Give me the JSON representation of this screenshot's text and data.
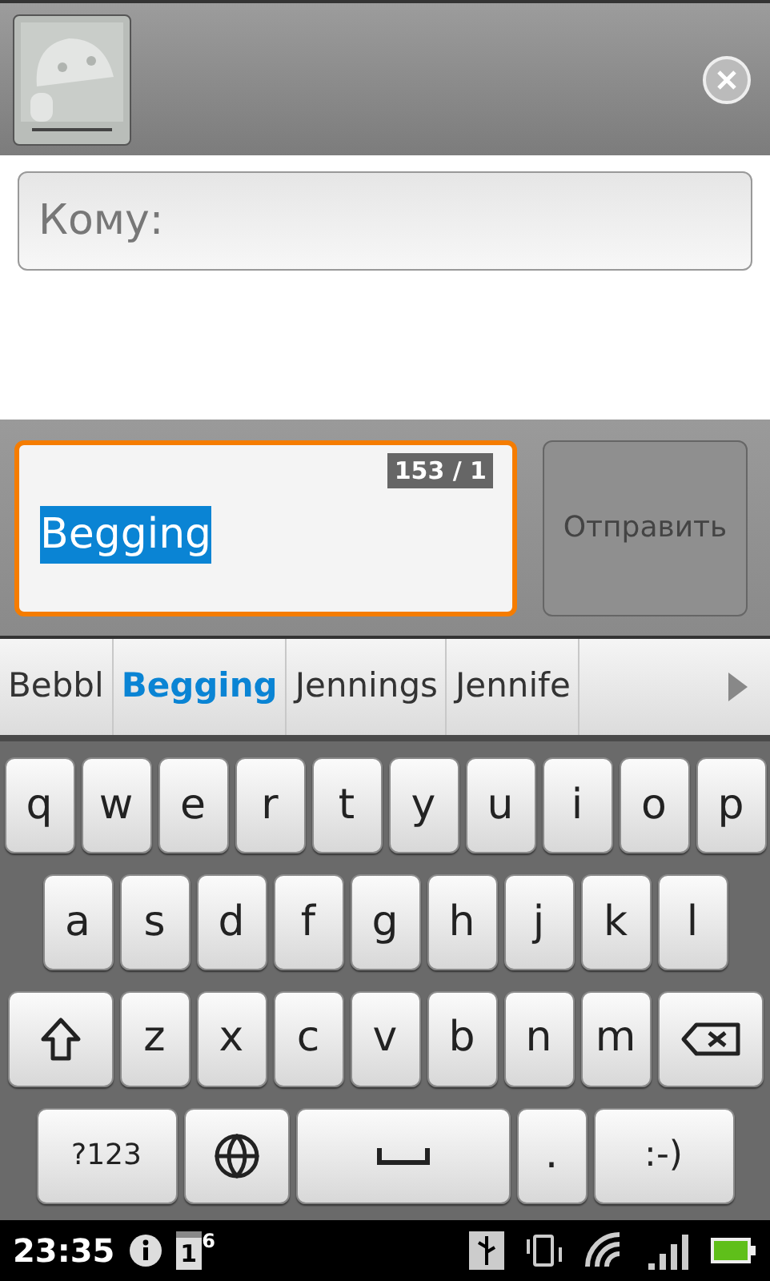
{
  "to_field": {
    "placeholder": "Кому:"
  },
  "compose": {
    "value": "Begging",
    "counter": "153 / 1",
    "focused": true
  },
  "send_button": {
    "label": "Отправить",
    "disabled": true
  },
  "suggestions": [
    {
      "text": "Bebbl",
      "selected": false
    },
    {
      "text": "Begging",
      "selected": true
    },
    {
      "text": "Jennings",
      "selected": false
    },
    {
      "text": "Jennife",
      "selected": false
    }
  ],
  "keyboard": {
    "rows": [
      [
        {
          "kind": "letter",
          "label": "q"
        },
        {
          "kind": "letter",
          "label": "w"
        },
        {
          "kind": "letter",
          "label": "e"
        },
        {
          "kind": "letter",
          "label": "r"
        },
        {
          "kind": "letter",
          "label": "t"
        },
        {
          "kind": "letter",
          "label": "y"
        },
        {
          "kind": "letter",
          "label": "u"
        },
        {
          "kind": "letter",
          "label": "i"
        },
        {
          "kind": "letter",
          "label": "o"
        },
        {
          "kind": "letter",
          "label": "p"
        }
      ],
      [
        {
          "kind": "letter",
          "label": "a"
        },
        {
          "kind": "letter",
          "label": "s"
        },
        {
          "kind": "letter",
          "label": "d"
        },
        {
          "kind": "letter",
          "label": "f"
        },
        {
          "kind": "letter",
          "label": "g"
        },
        {
          "kind": "letter",
          "label": "h"
        },
        {
          "kind": "letter",
          "label": "j"
        },
        {
          "kind": "letter",
          "label": "k"
        },
        {
          "kind": "letter",
          "label": "l"
        }
      ],
      [
        {
          "kind": "shift"
        },
        {
          "kind": "letter",
          "label": "z"
        },
        {
          "kind": "letter",
          "label": "x"
        },
        {
          "kind": "letter",
          "label": "c"
        },
        {
          "kind": "letter",
          "label": "v"
        },
        {
          "kind": "letter",
          "label": "b"
        },
        {
          "kind": "letter",
          "label": "n"
        },
        {
          "kind": "letter",
          "label": "m"
        },
        {
          "kind": "backspace"
        }
      ],
      [
        {
          "kind": "symbols",
          "label": "?123"
        },
        {
          "kind": "globe"
        },
        {
          "kind": "space"
        },
        {
          "kind": "letter",
          "label": "."
        },
        {
          "kind": "smiley",
          "label": ":-)"
        }
      ]
    ]
  },
  "status_bar": {
    "time": "23:35",
    "calendar_day": "1",
    "notification_count": "6"
  }
}
